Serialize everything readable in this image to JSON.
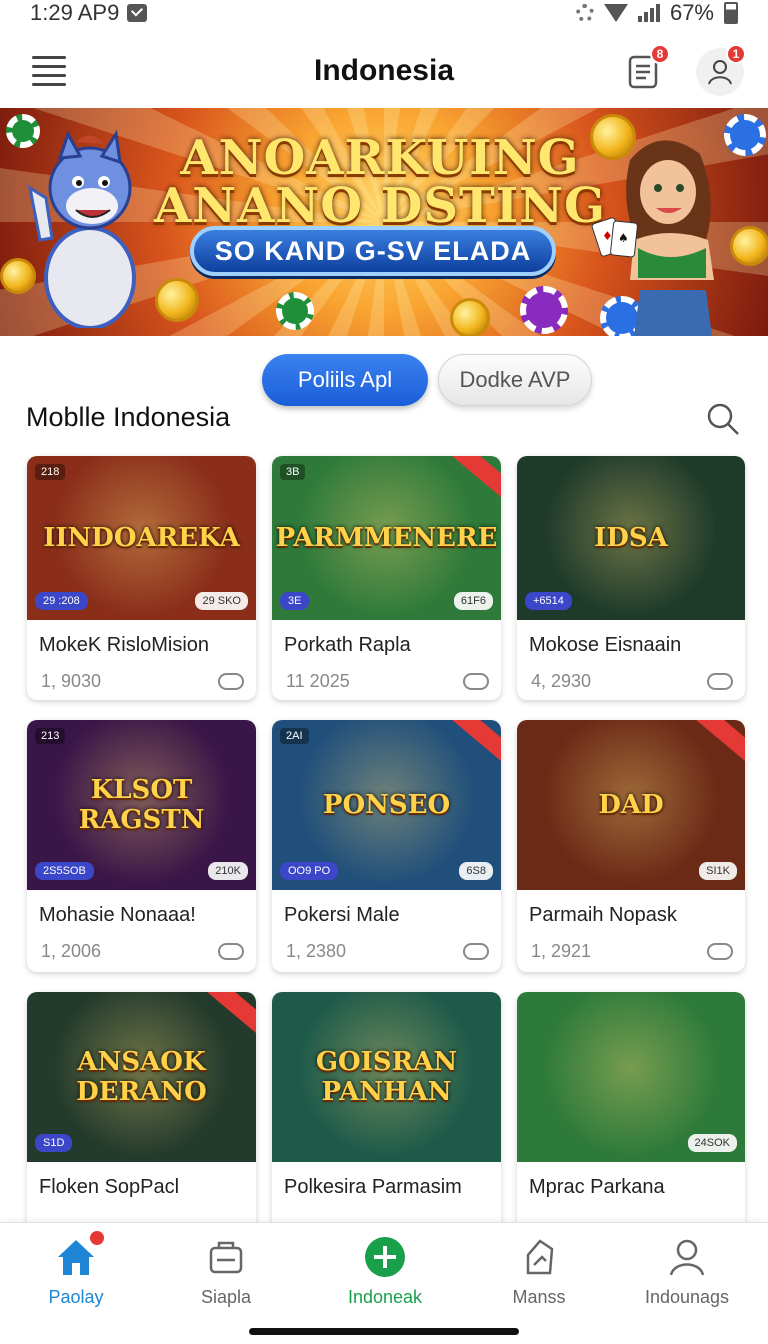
{
  "status_bar": {
    "time": "1:29 AP9",
    "battery": "67%"
  },
  "header": {
    "title": "Indonesia",
    "tasks_badge": "8",
    "profile_badge": "1"
  },
  "banner": {
    "title_line1": "ANOARKUING",
    "title_line2": "ANANO DSTING",
    "subtitle": "SO KAND G-SV ELADA"
  },
  "tabs": {
    "primary": "Poliils Apl",
    "secondary": "Dodke AVP"
  },
  "section": {
    "title": "Moblle Indonesia"
  },
  "games": [
    {
      "art_title": "IINDOAREKA",
      "tag_left": "29 :208",
      "tag_right": "29 SKO",
      "tag_top": "218",
      "name": "MokeK RisloMision",
      "count": "1, 9030",
      "bg": "#8a2e1a"
    },
    {
      "art_title": "PARMMENERE",
      "tag_left": "3E",
      "tag_right": "61F6",
      "tag_top": "3B",
      "name": "Porkath Rapla",
      "count": "11 2025",
      "bg": "#2f7a3a"
    },
    {
      "art_title": "IDSA",
      "tag_left": "+6514",
      "tag_right": "",
      "tag_top": "",
      "name": "Mokose Eisnaain",
      "count": "4, 2930",
      "bg": "#1d3a2a"
    },
    {
      "art_title": "KLSOT RAGSTN",
      "tag_left": "2S5SOB",
      "tag_right": "210K",
      "tag_top": "213",
      "name": "Mohasie Nonaaa!",
      "count": "1, 2006",
      "bg": "#3a1548"
    },
    {
      "art_title": "PONSEO",
      "tag_left": "OO9 PO",
      "tag_right": "6S8",
      "tag_top": "2AI",
      "name": "Pokersi Male",
      "count": "1, 2380",
      "bg": "#1f4f7a"
    },
    {
      "art_title": "DAD",
      "tag_left": "",
      "tag_right": "SI1K",
      "tag_top": "",
      "name": "Parmaih Nopask",
      "count": "1, 2921",
      "bg": "#6a2a16"
    },
    {
      "art_title": "ANSAOK DERANO",
      "tag_left": "S1D",
      "tag_right": "",
      "tag_top": "",
      "name": "Floken SopPacl",
      "count": "",
      "bg": "#233b2c"
    },
    {
      "art_title": "GOISRAN PANHAN",
      "tag_left": "",
      "tag_right": "",
      "tag_top": "",
      "name": "Polkesira Parmasim",
      "count": "",
      "bg": "#1d5a4a"
    },
    {
      "art_title": "",
      "tag_left": "",
      "tag_right": "24SOK",
      "tag_top": "",
      "name": "Mprac Parkana",
      "count": "",
      "bg": "#2e7a3a"
    }
  ],
  "bottom_nav": [
    {
      "label": "Paolay",
      "icon": "home-icon"
    },
    {
      "label": "Siapla",
      "icon": "briefcase-icon"
    },
    {
      "label": "Indoneak",
      "icon": "plus-circle-icon"
    },
    {
      "label": "Manss",
      "icon": "tag-icon"
    },
    {
      "label": "Indounags",
      "icon": "user-icon"
    }
  ],
  "colors": {
    "accent": "#1f86d6",
    "primary_pill": "#2a6fe4",
    "add": "#1aa04a",
    "badge": "#e53935"
  }
}
